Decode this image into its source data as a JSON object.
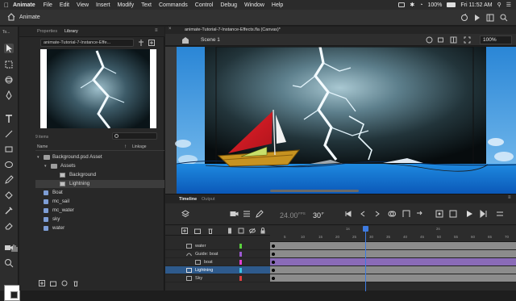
{
  "menubar": {
    "app_name": "Animate",
    "items": [
      "File",
      "Edit",
      "View",
      "Insert",
      "Modify",
      "Text",
      "Commands",
      "Control",
      "Debug",
      "Window",
      "Help"
    ],
    "battery": "100%",
    "clock": "Fri 11:52 AM"
  },
  "appbar": {
    "workspace": "Animate"
  },
  "tools": {
    "title": "To..."
  },
  "library": {
    "tabs": [
      "Properties",
      "Library"
    ],
    "active_tab": "Library",
    "document": "animate-Tutorial-7-Instance-Effe...",
    "item_count": "9 items",
    "columns": {
      "name": "Name",
      "linkage": "Linkage"
    },
    "items": [
      {
        "label": "Background.psd Asset",
        "type": "folder",
        "level": 0
      },
      {
        "label": "Assets",
        "type": "folder",
        "level": 1
      },
      {
        "label": "Background",
        "type": "bitmap",
        "level": 2
      },
      {
        "label": "Lightning",
        "type": "bitmap",
        "level": 2,
        "selected": true
      },
      {
        "label": "Boat",
        "type": "symbol",
        "level": 0
      },
      {
        "label": "mc_sail",
        "type": "symbol",
        "level": 0
      },
      {
        "label": "mc_water",
        "type": "symbol",
        "level": 0
      },
      {
        "label": "sky",
        "type": "symbol",
        "level": 0
      },
      {
        "label": "water",
        "type": "symbol",
        "level": 0
      }
    ]
  },
  "document": {
    "tab": "animate-Tutorial-7-Instance-Effects.fla (Canvas)*",
    "scene": "Scene 1",
    "zoom": "100%"
  },
  "timeline": {
    "tabs": [
      "Timeline",
      "Output"
    ],
    "active_tab": "Timeline",
    "fps": "24.00",
    "fps_unit": "FPS",
    "frame": "30",
    "frame_unit": "F",
    "ruler_seconds": [
      "1s",
      "2s"
    ],
    "ruler_frames": [
      "5",
      "10",
      "15",
      "20",
      "25",
      "30",
      "35",
      "40",
      "45",
      "50",
      "55",
      "60",
      "65",
      "70"
    ],
    "layers": [
      {
        "name": "water",
        "color": "#5ad13d",
        "indent": 0
      },
      {
        "name": "Guide: boat",
        "color": "#9b59d0",
        "indent": 0
      },
      {
        "name": "boat",
        "color": "#e03fd0",
        "indent": 1
      },
      {
        "name": "Lightning",
        "color": "#3fc3e0",
        "indent": 0,
        "selected": true
      },
      {
        "name": "Sky",
        "color": "#e0403f",
        "indent": 0
      }
    ]
  },
  "colors": {
    "accent_blue": "#3e7be0",
    "selection_blue": "#2e5a8c",
    "sail_red": "#d0202a",
    "hull_orange": "#c79320"
  }
}
